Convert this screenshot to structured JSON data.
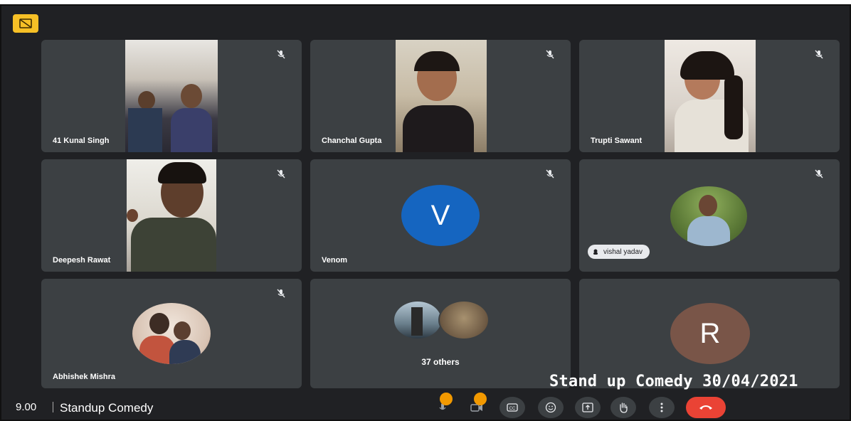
{
  "participants": [
    {
      "name": "41 Kunal Singh",
      "type": "video"
    },
    {
      "name": "Chanchal Gupta",
      "type": "video"
    },
    {
      "name": "Trupti Sawant",
      "type": "video"
    },
    {
      "name": "Deepesh Rawat",
      "type": "video"
    },
    {
      "name": "Venom",
      "type": "initial",
      "initial": "V",
      "color": "#1565c0"
    },
    {
      "name": "vishal yadav",
      "type": "photo"
    },
    {
      "name": "Abhishek Mishra",
      "type": "photo"
    },
    {
      "name": "37 others",
      "type": "group"
    },
    {
      "name": "",
      "type": "initial",
      "initial": "R",
      "color": "#795548"
    }
  ],
  "overlay_text": "Stand up Comedy 30/04/2021",
  "bottom_bar": {
    "time": "9.00",
    "meeting_title": "Standup Comedy"
  },
  "controls": [
    "mic-icon",
    "camera-icon",
    "captions-icon",
    "emoji-icon",
    "present-icon",
    "raise-hand-icon",
    "more-icon",
    "end-call-icon"
  ],
  "colors": {
    "background": "#202124",
    "tile": "#3c4043",
    "end_call": "#ea4335",
    "alert": "#f29900"
  }
}
